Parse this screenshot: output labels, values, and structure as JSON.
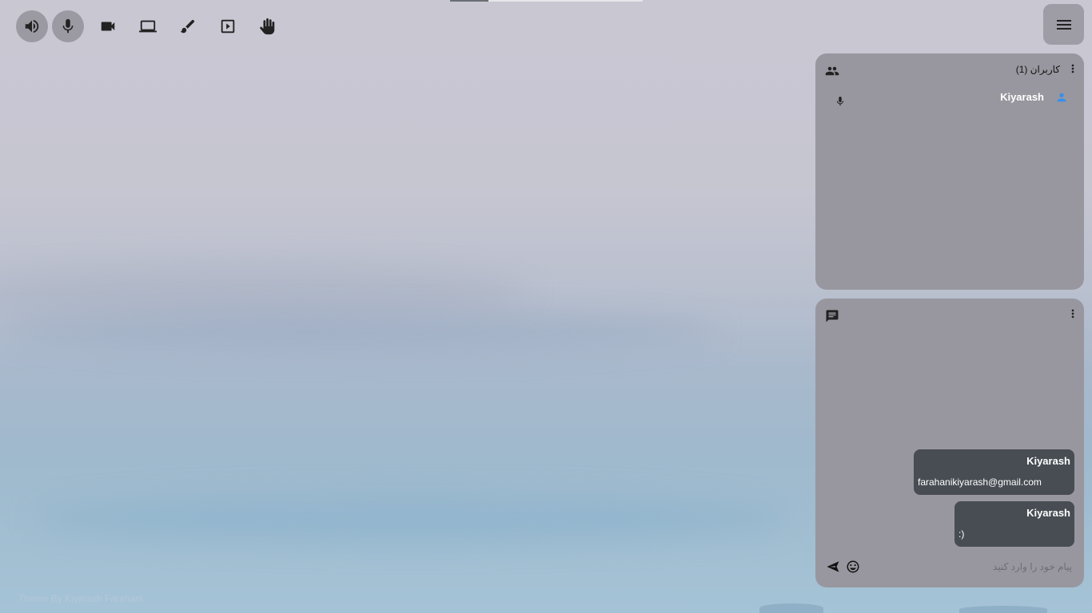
{
  "toolbar": {
    "buttons": [
      {
        "name": "speaker",
        "active": true
      },
      {
        "name": "microphone",
        "active": true
      },
      {
        "name": "camera",
        "active": false
      },
      {
        "name": "screen-share",
        "active": false
      },
      {
        "name": "whiteboard",
        "active": false
      },
      {
        "name": "presentation",
        "active": false
      },
      {
        "name": "raise-hand",
        "active": false
      }
    ]
  },
  "loading_progress": 0.2,
  "users_panel": {
    "title": "کاربران (1)",
    "users": [
      {
        "name": "Kiyarash"
      }
    ]
  },
  "chat_panel": {
    "messages": [
      {
        "author": "Kiyarash",
        "text": "farahanikiyarash@gmail.com"
      },
      {
        "author": "Kiyarash",
        "text": ":)"
      }
    ],
    "input_placeholder": "پیام خود را وارد کنید"
  },
  "footer": {
    "credit": "Theme By Kiyarash Farahani"
  },
  "colors": {
    "panel_bg": "#98979f",
    "message_bg": "#474d53",
    "user_icon": "#3b8fe8"
  }
}
